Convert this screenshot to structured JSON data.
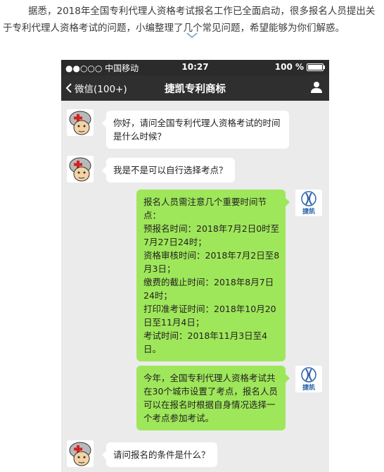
{
  "intro_text": "据悉，2018年全国专利代理人资格考试报名工作已全面启动，很多报名人员提出关于专利代理人资格考试的问题，小编整理了几个常见问题，希望能够为你们解惑。",
  "status_bar": {
    "carrier": "●●○○○ 中国移动",
    "time": "10:27",
    "battery": "100 %"
  },
  "nav": {
    "back_label": "微信(100+)",
    "title": "捷凯专利商标"
  },
  "brand_logo_text": "捷凯",
  "messages": [
    {
      "lines": [
        "你好，请问全国专利代理人资格考试的时间",
        "是什么时候？"
      ]
    },
    {
      "lines": [
        "我是不是可以自行选择考点？"
      ]
    },
    {
      "lines": [
        "报名人员需注意几个重要时间节",
        "点：",
        "预报名时间：2018年7月2日0时至",
        "7月27日24时；",
        "资格审核时间：2018年7月2日至8",
        "月3日；",
        "缴费的截止时间：2018年8月7日",
        "24时；",
        "打印准考证时间：2018年10月20",
        "日至11月4日；",
        "考试时间：2018年11月3日至4",
        "日。"
      ]
    },
    {
      "lines": [
        "今年，全国专利代理人资格考试共",
        "在30个城市设置了考点，报名人员",
        "可以在报名时根据自身情况选择一",
        "个考点参加考试。"
      ]
    },
    {
      "lines": [
        "请问报名的条件是什么？"
      ]
    }
  ],
  "colors": {
    "sent_bubble": "#9fe75a",
    "received_bubble": "#ffffff",
    "chat_bg": "#ebebeb",
    "nav_bg": "#2f2f2f"
  }
}
